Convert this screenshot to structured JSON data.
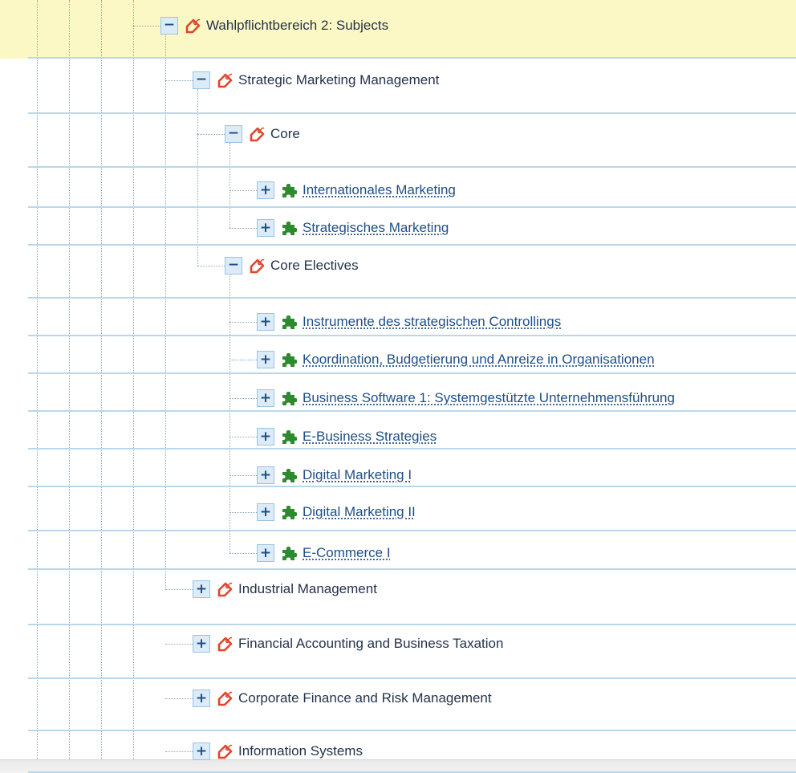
{
  "tree": {
    "highlight_color": "#fcf8c6",
    "border_color": "#b9d7ec",
    "tag_icon_color": "#e0462b",
    "module_icon_color": "#2e8a2e",
    "toggle_expanded": "−",
    "toggle_collapsed": "+",
    "nodes": [
      {
        "label": "Wahlpflichtbereich 2: Subjects",
        "state": "expanded",
        "icon": "tag-icon",
        "link": false
      },
      {
        "label": "Strategic Marketing Management",
        "state": "expanded",
        "icon": "tag-icon",
        "link": false
      },
      {
        "label": "Core",
        "state": "expanded",
        "icon": "tag-icon",
        "link": false
      },
      {
        "label": "Internationales Marketing",
        "state": "collapsed",
        "icon": "puzzle-piece-icon",
        "link": true
      },
      {
        "label": "Strategisches Marketing",
        "state": "collapsed",
        "icon": "puzzle-piece-icon",
        "link": true
      },
      {
        "label": "Core Electives",
        "state": "expanded",
        "icon": "tag-icon",
        "link": false
      },
      {
        "label": "Instrumente des strategischen Controllings",
        "state": "collapsed",
        "icon": "puzzle-piece-icon",
        "link": true
      },
      {
        "label": "Koordination, Budgetierung und Anreize in Organisationen",
        "state": "collapsed",
        "icon": "puzzle-piece-icon",
        "link": true
      },
      {
        "label": "Business Software 1: Systemgestützte Unternehmensführung",
        "state": "collapsed",
        "icon": "puzzle-piece-icon",
        "link": true
      },
      {
        "label": "E-Business Strategies",
        "state": "collapsed",
        "icon": "puzzle-piece-icon",
        "link": true
      },
      {
        "label": "Digital Marketing I",
        "state": "collapsed",
        "icon": "puzzle-piece-icon",
        "link": true
      },
      {
        "label": "Digital Marketing II",
        "state": "collapsed",
        "icon": "puzzle-piece-icon",
        "link": true
      },
      {
        "label": "E-Commerce I",
        "state": "collapsed",
        "icon": "puzzle-piece-icon",
        "link": true
      },
      {
        "label": "Industrial Management",
        "state": "collapsed",
        "icon": "tag-icon",
        "link": false
      },
      {
        "label": "Financial Accounting and Business Taxation",
        "state": "collapsed",
        "icon": "tag-icon",
        "link": false
      },
      {
        "label": "Corporate Finance and Risk Management",
        "state": "collapsed",
        "icon": "tag-icon",
        "link": false
      },
      {
        "label": "Information Systems",
        "state": "collapsed",
        "icon": "tag-icon",
        "link": false
      }
    ]
  }
}
